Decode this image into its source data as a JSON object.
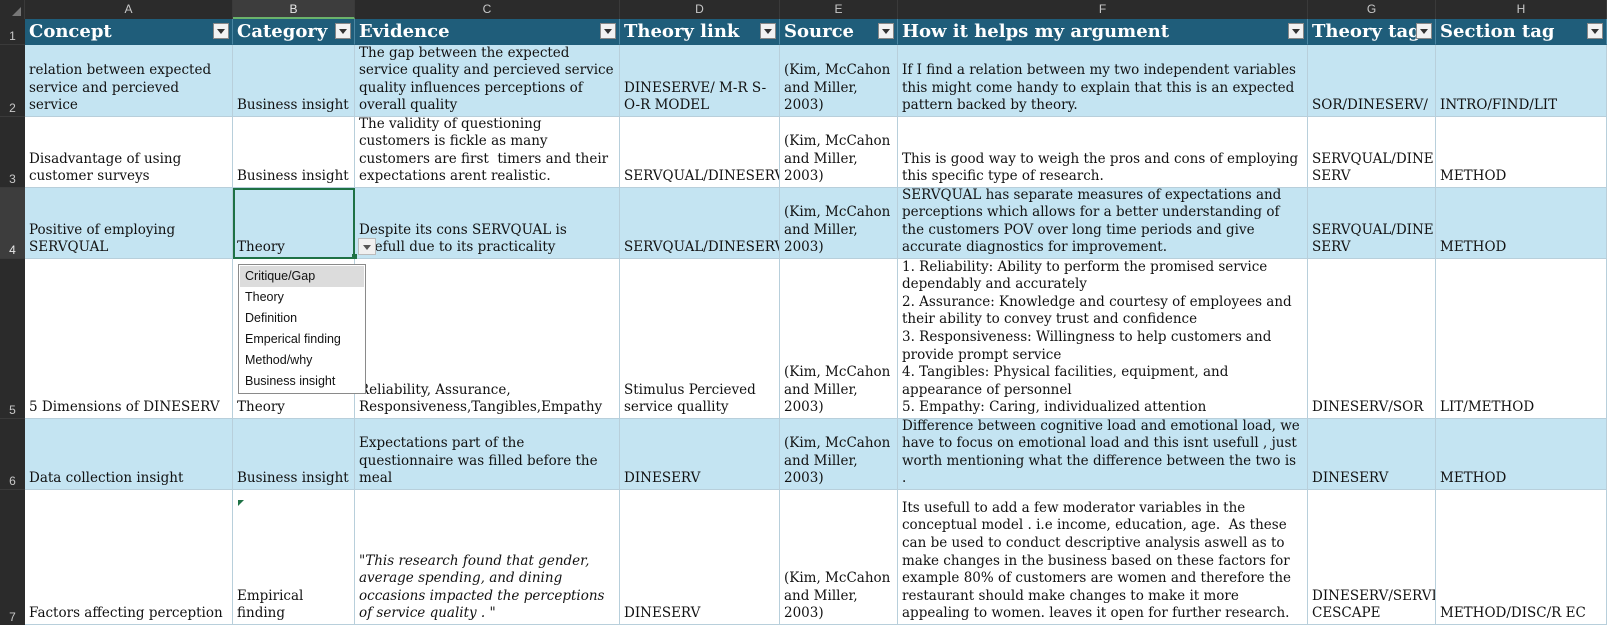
{
  "columns": [
    "A",
    "B",
    "C",
    "D",
    "E",
    "F",
    "G",
    "H"
  ],
  "rows": [
    "1",
    "2",
    "3",
    "4",
    "5",
    "6",
    "7"
  ],
  "headers": {
    "concept": "Concept",
    "category": "Category",
    "evidence": "Evidence",
    "theory_link": "Theory link",
    "source": "Source",
    "how_helps": "How it helps my argument",
    "theory_tag": "Theory tag",
    "section_tag": "Section tag"
  },
  "data": [
    {
      "concept": "relation between expected service and percieved service",
      "category": "Business insight",
      "evidence": "The gap between the expected service quality and percieved service quality influences perceptions of overall quality",
      "theory_link": "DINESERVE/ M-R S-O-R MODEL",
      "source": "(Kim, McCahon and Miller, 2003)",
      "how_helps": "If I find a relation between my two independent variables this might come handy to explain that this is an expected pattern backed by theory.",
      "theory_tag": "SOR/DINESERV/",
      "section_tag": "INTRO/FIND/LIT"
    },
    {
      "concept": "Disadvantage of using customer surveys",
      "category": "Business insight",
      "evidence": "The validity of questioning customers is fickle as many customers are first  timers and their expectations arent realistic.",
      "theory_link": "SERVQUAL/DINESERV",
      "source": "(Kim, McCahon and Miller, 2003)",
      "how_helps": "This is good way to weigh the pros and cons of employing this specific type of research.",
      "theory_tag": "SERVQUAL/DINE SERV",
      "section_tag": "METHOD"
    },
    {
      "concept": "Positive of employing SERVQUAL",
      "category": "Theory",
      "evidence": "Despite its cons SERVQUAL is usefull due to its practicality",
      "theory_link": "SERVQUAL/DINESERV",
      "source": "(Kim, McCahon and Miller, 2003)",
      "how_helps": "SERVQUAL has separate measures of expectations and perceptions which allows for a better understanding of the customers POV over long time periods and give accurate diagnostics for improvement.",
      "theory_tag": "SERVQUAL/DINE SERV",
      "section_tag": "METHOD"
    },
    {
      "concept": "5 Dimensions of DINESERV",
      "category": "Theory",
      "evidence": "Reliability, Assurance, Responsiveness,Tangibles,Empathy",
      "theory_link": "Stimulus Percieved service quallity",
      "source": "(Kim, McCahon and Miller, 2003)",
      "how_helps": "1. Reliability: Ability to perform the promised service dependably and accurately\n2. Assurance: Knowledge and courtesy of employees and their ability to convey trust and confidence\n3. Responsiveness: Willingness to help customers and provide prompt service\n4. Tangibles: Physical facilities, equipment, and appearance of personnel\n5. Empathy: Caring, individualized attention",
      "theory_tag": "DINESERV/SOR",
      "section_tag": "LIT/METHOD"
    },
    {
      "concept": "Data collection insight",
      "category": "Business insight",
      "evidence": "Expectations part of the questionnaire was filled before the meal",
      "theory_link": "DINESERV",
      "source": "(Kim, McCahon and Miller, 2003)",
      "how_helps": "Difference between cognitive load and emotional load, we have to focus on emotional load and this isnt usefull , just worth mentioning what the difference between the two is .",
      "theory_tag": "DINESERV",
      "section_tag": "METHOD"
    },
    {
      "concept": "Factors affecting perception",
      "category": "Empirical finding",
      "evidence": "\"This research found that gender, average spending, and dining occasions impacted the perceptions of service quality . \"",
      "theory_link": "DINESERV",
      "source": "(Kim, McCahon and Miller, 2003)",
      "how_helps": "Its usefull to add a few moderator variables in the conceptual model . i.e income, education, age.  As these can be used to conduct descriptive analysis aswell as to make changes in the business based on these factors for example 80% of customers are women and therefore the restaurant should make changes to make it more appealing to women. leaves it open for further research.",
      "theory_tag": "DINESERV/SERVI CESCAPE",
      "section_tag": "METHOD/DISC/R EC"
    }
  ],
  "dropdown_options": [
    "Critique/Gap",
    "Theory",
    "Definition",
    "Emperical finding",
    "Method/why",
    "Business insight"
  ],
  "colors": {
    "header_fill": "#1f5d7a",
    "band_fill": "#c4e4f2",
    "selection": "#1e7145"
  }
}
